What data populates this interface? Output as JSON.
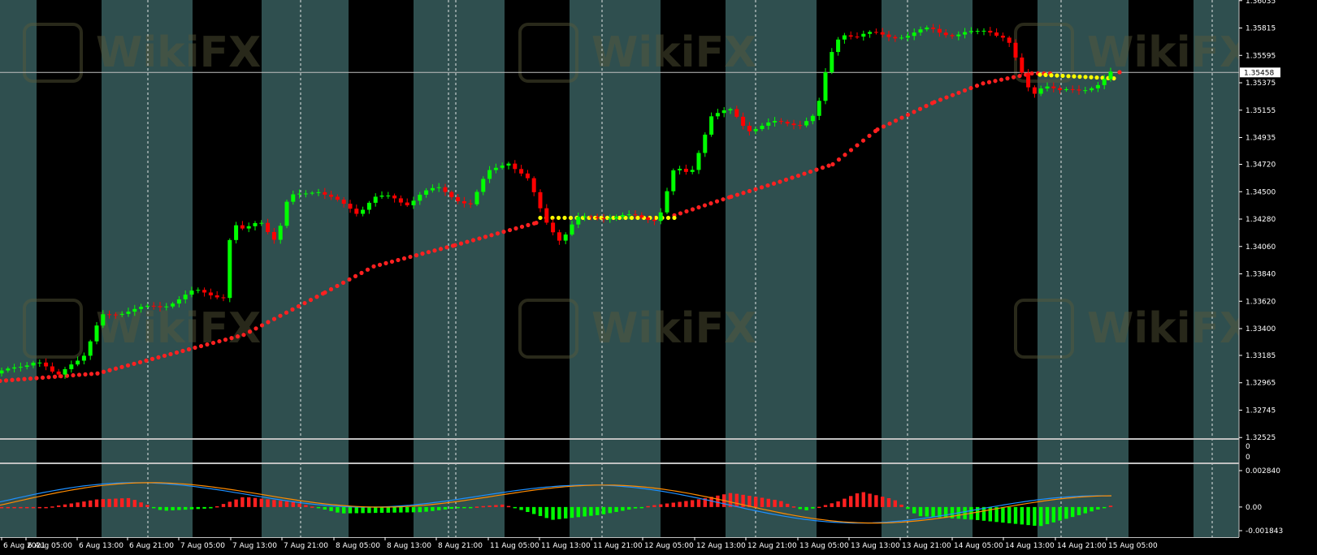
{
  "chart_data": {
    "type": "candlestick",
    "symbol": "",
    "colors": {
      "background": "#000000",
      "session_band": "#2f4f4f",
      "bull": "#00ff00",
      "bear": "#ff0000",
      "sar_below": "#ff2020",
      "sar_flat": "#ffff00",
      "macd_main": "#1e90ff",
      "macd_signal": "#ff8c00",
      "hist_pos": "#ff2020",
      "hist_neg": "#00ff00",
      "grid": "#ffffff",
      "axis_text": "#ffffff"
    },
    "price_axis": {
      "ylim": [
        1.3252,
        1.3604
      ],
      "ticks": [
        "1.36035",
        "1.35815",
        "1.35595",
        "1.35375",
        "1.35155",
        "1.34935",
        "1.34720",
        "1.34500",
        "1.34280",
        "1.34060",
        "1.33840",
        "1.33620",
        "1.33400",
        "1.33185",
        "1.32965",
        "1.32745",
        "1.32525"
      ],
      "current_price": "1.35458"
    },
    "middle_pane_axis": [
      "0",
      "0"
    ],
    "macd_axis": {
      "ylim": [
        -0.001843,
        0.00284
      ],
      "ticks": [
        "0.002840",
        "0.00",
        "-0.001843"
      ]
    },
    "time_labels": [
      "6 Aug 2021",
      "6 Aug 05:00",
      "6 Aug 13:00",
      "6 Aug 21:00",
      "7 Aug 05:00",
      "7 Aug 13:00",
      "7 Aug 21:00",
      "8 Aug 05:00",
      "8 Aug 13:00",
      "8 Aug 21:00",
      "11 Aug 05:00",
      "11 Aug 13:00",
      "11 Aug 21:00",
      "12 Aug 05:00",
      "12 Aug 13:00",
      "12 Aug 21:00",
      "13 Aug 05:00",
      "13 Aug 13:00",
      "13 Aug 21:00",
      "14 Aug 05:00",
      "14 Aug 13:00",
      "14 Aug 21:00",
      "15 Aug 05:00"
    ],
    "watermark": "WikiFX"
  }
}
